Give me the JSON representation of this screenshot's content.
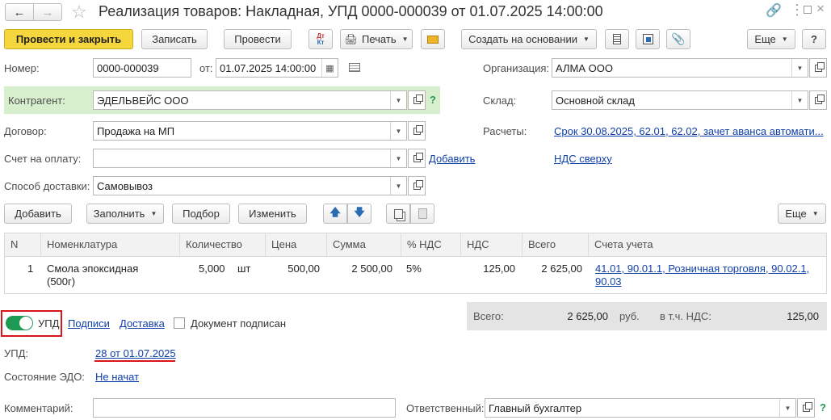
{
  "window": {
    "title": "Реализация товаров: Накладная, УПД 0000-000039 от 01.07.2025 14:00:00"
  },
  "toolbar": {
    "post_close": "Провести и закрыть",
    "save": "Записать",
    "post": "Провести",
    "dtkt_top": "Дт",
    "dtkt_bottom": "Кт",
    "print": "Печать",
    "create_based": "Создать на основании",
    "more": "Еще"
  },
  "header": {
    "number_label": "Номер:",
    "number_value": "0000-000039",
    "date_label": "от:",
    "date_value": "01.07.2025 14:00:00",
    "org_label": "Организация:",
    "org_value": "АЛМА ООО",
    "counterparty_label": "Контрагент:",
    "counterparty_value": "ЭДЕЛЬВЕЙС ООО",
    "help": "?",
    "warehouse_label": "Склад:",
    "warehouse_value": "Основной склад",
    "contract_label": "Договор:",
    "contract_value": "Продажа на МП",
    "settlements_label": "Расчеты:",
    "settlements_link": "Срок 30.08.2025, 62.01, 62.02, зачет аванса автомати...",
    "invoice_label": "Счет на оплату:",
    "invoice_value": "",
    "invoice_add": "Добавить",
    "vat_link": "НДС сверху",
    "delivery_label": "Способ доставки:",
    "delivery_value": "Самовывоз"
  },
  "table_toolbar": {
    "add": "Добавить",
    "fill": "Заполнить",
    "select": "Подбор",
    "change": "Изменить",
    "more": "Еще"
  },
  "table": {
    "columns": [
      "N",
      "Номенклатура",
      "Количество",
      "Цена",
      "Сумма",
      "% НДС",
      "НДС",
      "Всего",
      "Счета учета"
    ],
    "rows": [
      {
        "n": "1",
        "item_line1": "Смола эпоксидная",
        "item_line2": "(500г)",
        "qty": "5,000",
        "unit": "шт",
        "price": "500,00",
        "sum": "2 500,00",
        "vat_rate": "5%",
        "vat": "125,00",
        "total": "2 625,00",
        "accounts_line1": "41.01, 90.01.1, Розничная торговля, 90.02.1,",
        "accounts_line2": "90.03"
      }
    ]
  },
  "footer": {
    "upd_toggle_label": "УПД",
    "signatures_link": "Подписи",
    "delivery_link": "Доставка",
    "signed_label": "Документ подписан",
    "total_label": "Всего:",
    "total_value": "2 625,00",
    "currency": "руб.",
    "vat_incl_label": "в т.ч. НДС:",
    "vat_incl_value": "125,00",
    "upd_label": "УПД:",
    "upd_link": "28 от 01.07.2025",
    "edo_label": "Состояние ЭДО:",
    "edo_link": "Не начат",
    "comment_label": "Комментарий:",
    "comment_value": "",
    "responsible_label": "Ответственный:",
    "responsible_value": "Главный бухгалтер",
    "help": "?"
  },
  "colors": {
    "primary_button": "#f5d63c",
    "link": "#0f3fa8",
    "toggle_on": "#1f9a54",
    "highlight_frame": "#d9141a",
    "counterparty_bg": "#d7efcc"
  }
}
